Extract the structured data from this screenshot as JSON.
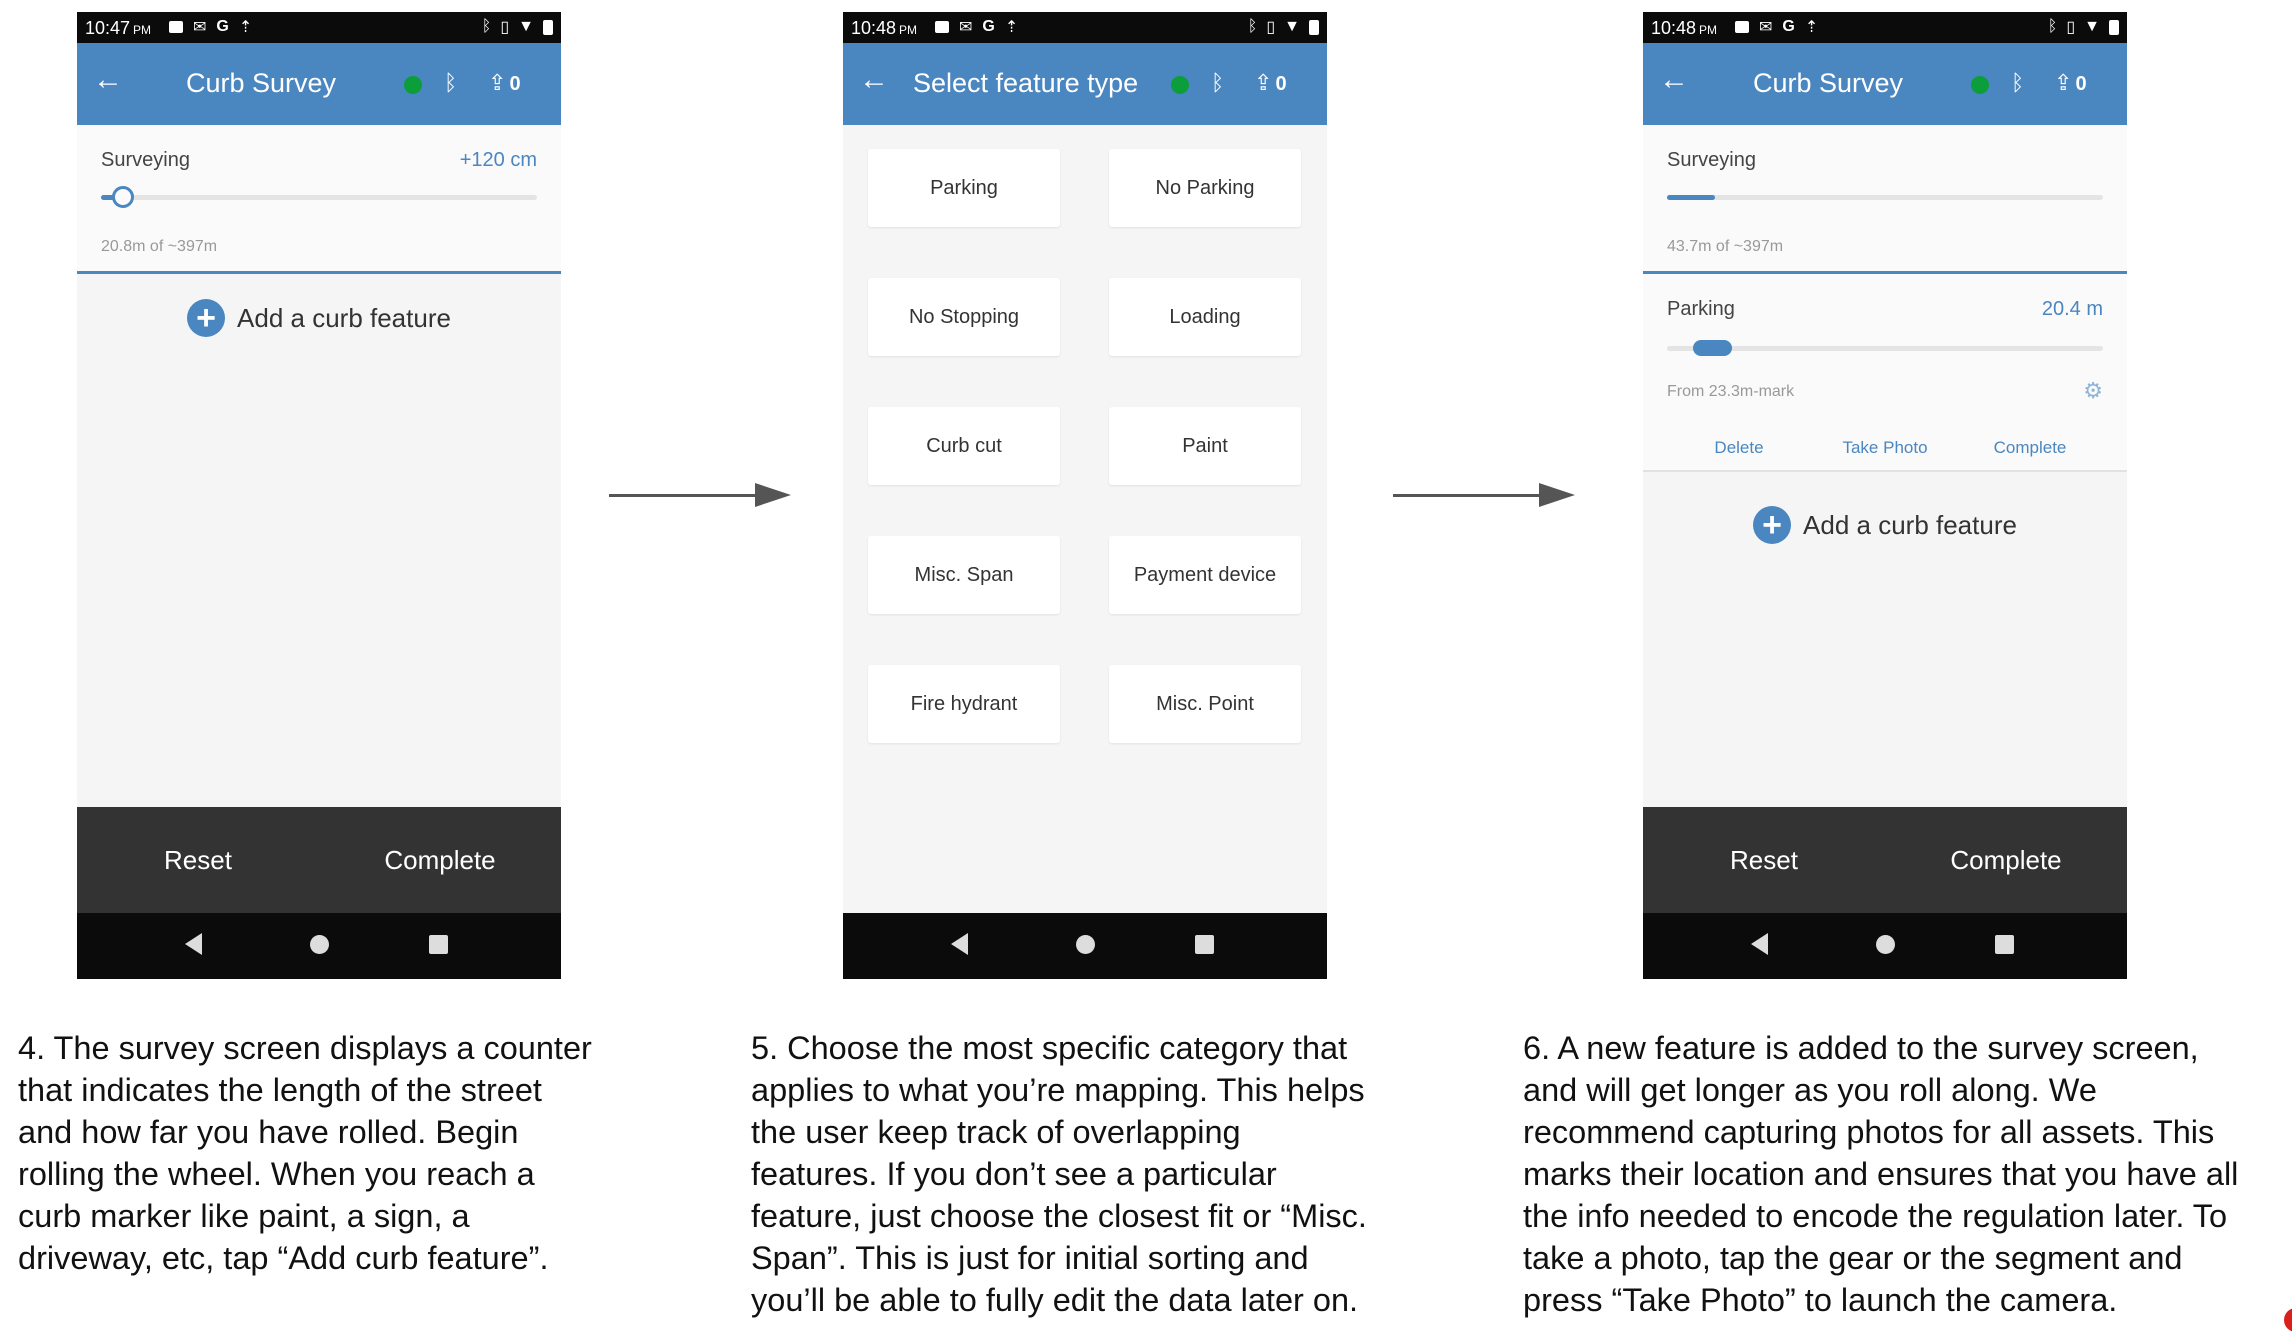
{
  "screens": [
    {
      "status": {
        "time": "10:47",
        "ampm": "PM"
      },
      "title": "Curb Survey",
      "upload_count": "0",
      "surveying": {
        "label": "Surveying",
        "delta": "+120 cm",
        "progress_text": "20.8m of ~397m",
        "progress_fraction": 0.05
      },
      "add_feature": "Add a curb feature",
      "actions": {
        "reset": "Reset",
        "complete": "Complete"
      }
    },
    {
      "status": {
        "time": "10:48",
        "ampm": "PM"
      },
      "title": "Select feature type",
      "upload_count": "0",
      "feature_types": [
        "Parking",
        "No Parking",
        "No Stopping",
        "Loading",
        "Curb cut",
        "Paint",
        "Misc. Span",
        "Payment device",
        "Fire hydrant",
        "Misc. Point"
      ]
    },
    {
      "status": {
        "time": "10:48",
        "ampm": "PM"
      },
      "title": "Curb Survey",
      "upload_count": "0",
      "surveying": {
        "label": "Surveying",
        "progress_text": "43.7m of ~397m",
        "progress_fraction": 0.11
      },
      "feature": {
        "name": "Parking",
        "length": "20.4 m",
        "from_text": "From 23.3m-mark",
        "start_fraction": 0.06,
        "end_fraction": 0.11,
        "actions": {
          "delete": "Delete",
          "take_photo": "Take Photo",
          "complete": "Complete"
        }
      },
      "add_feature": "Add a curb feature",
      "actions": {
        "reset": "Reset",
        "complete": "Complete"
      }
    }
  ],
  "captions": [
    [
      "4. The survey screen displays a counter",
      "that indicates the length of the street",
      "and how far you have rolled. Begin",
      "rolling the wheel. When you reach a",
      "curb marker like paint, a sign, a",
      "driveway, etc, tap “Add curb feature”."
    ],
    [
      "5. Choose the most specific category that",
      "applies to what you’re mapping. This helps",
      "the user keep track of overlapping",
      "features. If you don’t see a particular",
      "feature, just choose the closest fit or “Misc.",
      "Span”. This is just for initial sorting and",
      "you’ll be able to fully edit the data later on."
    ],
    [
      "6. A new feature is added to the survey screen,",
      "and will get longer as you roll along. We",
      "recommend capturing photos for all assets. This",
      "marks their location and ensures that you have all",
      "the info needed to encode the regulation later. To",
      "take a photo, tap the gear or the segment and",
      "press “Take Photo” to launch the camera."
    ]
  ],
  "colors": {
    "appbar": "#4a86c0",
    "accent": "#4a86c0",
    "connected_dot": "#0b9e3b",
    "bottom_bar": "#333333"
  },
  "icons": [
    "back-arrow-icon",
    "bluetooth-icon",
    "upload-icon",
    "plus-circle-icon",
    "gear-icon",
    "nav-back-icon",
    "nav-home-icon",
    "nav-recents-icon"
  ]
}
